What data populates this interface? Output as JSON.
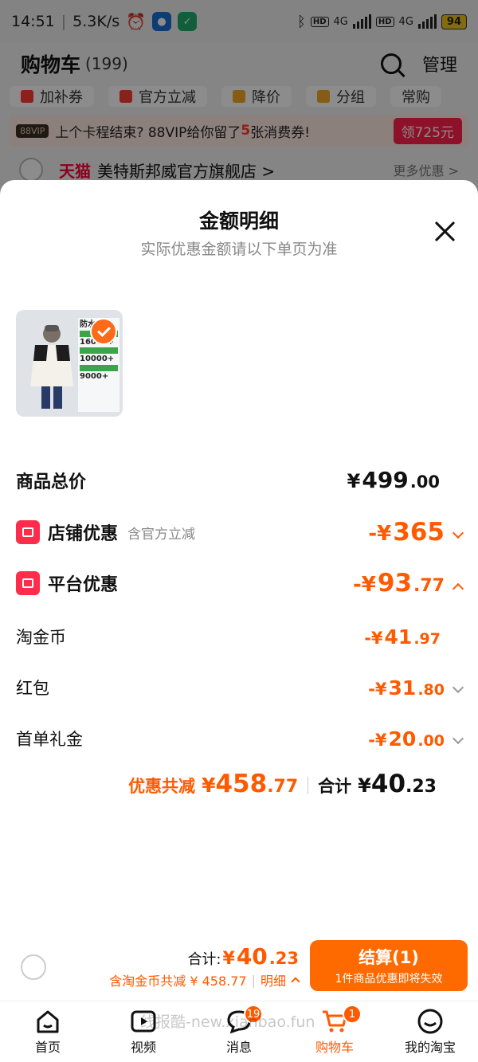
{
  "status_bar": {
    "time": "14:51",
    "speed": "5.3K/s",
    "net1": "4G",
    "net2": "4G",
    "hd": "HD",
    "battery": "94"
  },
  "cart": {
    "title": "购物车",
    "count": "(199)",
    "manage_label": "管理",
    "chips": [
      "加补券",
      "官方立减",
      "降价",
      "分组",
      "常购"
    ],
    "vip_tag": "88VIP",
    "vip_text_before": "上个卡程结束? 88VIP给你留了",
    "vip_count": "5",
    "vip_text_after": "张消费券!",
    "vip_button": "领725元",
    "store_brand": "天猫",
    "store_name": "美特斯邦威官方旗舰店 >",
    "store_more": "更多优惠 >"
  },
  "sheet": {
    "title": "金额明细",
    "subtitle": "实际优惠金额请以下单页为准",
    "product_thumb_text": {
      "heading": "防水",
      "line1": "16000+",
      "line2": "10000+",
      "line3": "9000+"
    },
    "rows": {
      "total": {
        "label": "商品总价",
        "currency": "¥",
        "int": "499",
        "dec": ".00"
      },
      "store": {
        "label": "店铺优惠",
        "note": "含官方立减",
        "prefix": "-¥",
        "int": "365",
        "dec": ""
      },
      "platform": {
        "label": "平台优惠",
        "prefix": "-¥",
        "int": "93",
        "dec": ".77"
      },
      "coins": {
        "label": "淘金币",
        "prefix": "-¥",
        "int": "41",
        "dec": ".97"
      },
      "redpacket": {
        "label": "红包",
        "prefix": "-¥",
        "int": "31",
        "dec": ".80"
      },
      "firstorder": {
        "label": "首单礼金",
        "prefix": "-¥",
        "int": "20",
        "dec": ".00"
      }
    },
    "summary": {
      "discount_label": "优惠共减",
      "discount_currency": "¥",
      "discount_int": "458",
      "discount_dec": ".77",
      "total_label": "合计",
      "total_currency": "¥",
      "total_int": "40",
      "total_dec": ".23"
    }
  },
  "checkout": {
    "total_label": "合计:",
    "total_currency": "¥",
    "total_int": "40",
    "total_dec": ".23",
    "sub_text": "含淘金币共减 ¥ 458.77",
    "sub_sep": "|",
    "detail_label": "明细",
    "button_main": "结算(1)",
    "button_sub": "1件商品优惠即将失效"
  },
  "tabbar": {
    "tabs": [
      {
        "label": "首页",
        "icon": "home-icon"
      },
      {
        "label": "视频",
        "icon": "video-icon"
      },
      {
        "label": "消息",
        "icon": "message-icon",
        "badge": "19"
      },
      {
        "label": "购物车",
        "icon": "cart-icon",
        "badge": "1"
      },
      {
        "label": "我的淘宝",
        "icon": "profile-icon"
      }
    ]
  },
  "watermark": "线报酷-new.xianbao.fun",
  "colors": {
    "accent": "#ff5a00",
    "checkout_button": "#ff6a00",
    "promo_red": "#ff2d4b"
  }
}
